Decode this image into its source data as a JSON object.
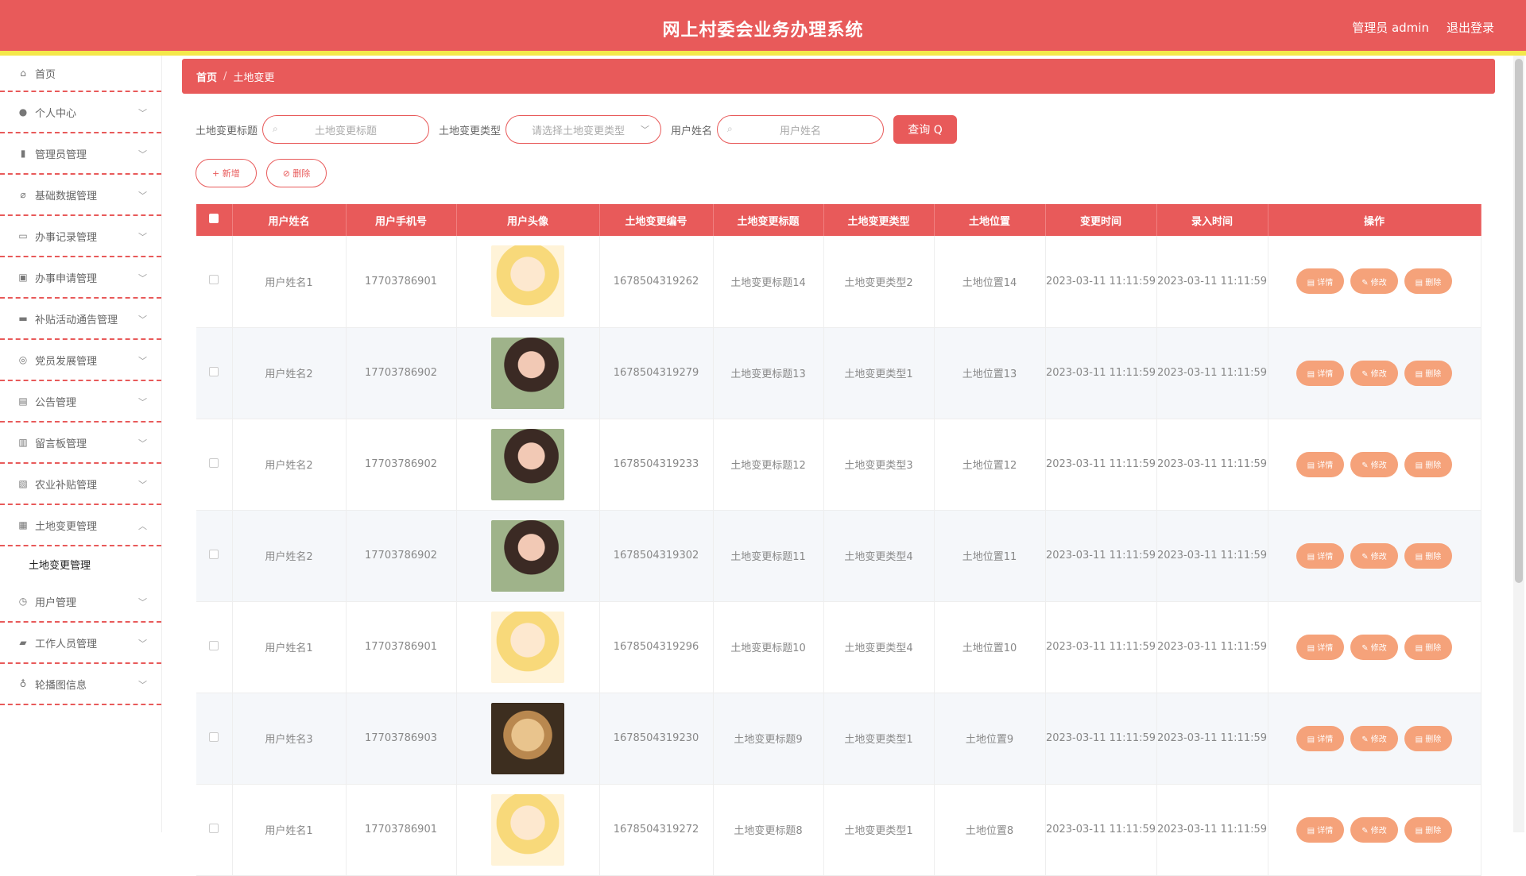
{
  "header": {
    "title": "网上村委会业务办理系统",
    "user_label": "管理员 admin",
    "logout_label": "退出登录"
  },
  "sidebar": {
    "items": [
      {
        "label": "首页",
        "icon": "home-icon"
      },
      {
        "label": "个人中心",
        "icon": "user-icon"
      },
      {
        "label": "管理员管理",
        "icon": "admin-icon"
      },
      {
        "label": "基础数据管理",
        "icon": "data-icon"
      },
      {
        "label": "办事记录管理",
        "icon": "record-icon"
      },
      {
        "label": "办事申请管理",
        "icon": "apply-icon"
      },
      {
        "label": "补贴活动通告管理",
        "icon": "notice-icon"
      },
      {
        "label": "党员发展管理",
        "icon": "party-icon"
      },
      {
        "label": "公告管理",
        "icon": "bulletin-icon"
      },
      {
        "label": "留言板管理",
        "icon": "message-icon"
      },
      {
        "label": "农业补贴管理",
        "icon": "subsidy-icon"
      },
      {
        "label": "土地变更管理",
        "icon": "land-icon"
      },
      {
        "label": "用户管理",
        "icon": "clock-icon"
      },
      {
        "label": "工作人员管理",
        "icon": "staff-icon"
      },
      {
        "label": "轮播图信息",
        "icon": "mic-icon"
      }
    ],
    "sub_item": "土地变更管理"
  },
  "breadcrumb": {
    "home": "首页",
    "current": "土地变更"
  },
  "search": {
    "title_label": "土地变更标题",
    "title_placeholder": "土地变更标题",
    "type_label": "土地变更类型",
    "type_placeholder": "请选择土地变更类型",
    "name_label": "用户姓名",
    "name_placeholder": "用户姓名",
    "query_button": "查询 Q"
  },
  "actions": {
    "add": "+ 新增",
    "delete": "⊘ 删除"
  },
  "table": {
    "headers": [
      "用户姓名",
      "用户手机号",
      "用户头像",
      "土地变更编号",
      "土地变更标题",
      "土地变更类型",
      "土地位置",
      "变更时间",
      "录入时间",
      "操作"
    ],
    "op_labels": {
      "detail": "▤ 详情",
      "edit": "✎ 修改",
      "del": "▤ 删除"
    },
    "rows": [
      {
        "name": "用户姓名1",
        "phone": "17703786901",
        "avatar": "anime",
        "no": "1678504319262",
        "title": "土地变更标题14",
        "type": "土地变更类型2",
        "loc": "土地位置14",
        "change": "2023-03-11 11:11:59",
        "entry": "2023-03-11 11:11:59"
      },
      {
        "name": "用户姓名2",
        "phone": "17703786902",
        "avatar": "girl",
        "no": "1678504319279",
        "title": "土地变更标题13",
        "type": "土地变更类型1",
        "loc": "土地位置13",
        "change": "2023-03-11 11:11:59",
        "entry": "2023-03-11 11:11:59"
      },
      {
        "name": "用户姓名2",
        "phone": "17703786902",
        "avatar": "girl",
        "no": "1678504319233",
        "title": "土地变更标题12",
        "type": "土地变更类型3",
        "loc": "土地位置12",
        "change": "2023-03-11 11:11:59",
        "entry": "2023-03-11 11:11:59"
      },
      {
        "name": "用户姓名2",
        "phone": "17703786902",
        "avatar": "girl",
        "no": "1678504319302",
        "title": "土地变更标题11",
        "type": "土地变更类型4",
        "loc": "土地位置11",
        "change": "2023-03-11 11:11:59",
        "entry": "2023-03-11 11:11:59"
      },
      {
        "name": "用户姓名1",
        "phone": "17703786901",
        "avatar": "anime",
        "no": "1678504319296",
        "title": "土地变更标题10",
        "type": "土地变更类型4",
        "loc": "土地位置10",
        "change": "2023-03-11 11:11:59",
        "entry": "2023-03-11 11:11:59"
      },
      {
        "name": "用户姓名3",
        "phone": "17703786903",
        "avatar": "dog",
        "no": "1678504319230",
        "title": "土地变更标题9",
        "type": "土地变更类型1",
        "loc": "土地位置9",
        "change": "2023-03-11 11:11:59",
        "entry": "2023-03-11 11:11:59"
      },
      {
        "name": "用户姓名1",
        "phone": "17703786901",
        "avatar": "anime",
        "no": "1678504319272",
        "title": "土地变更标题8",
        "type": "土地变更类型1",
        "loc": "土地位置8",
        "change": "2023-03-11 11:11:59",
        "entry": "2023-03-11 11:11:59"
      }
    ]
  }
}
